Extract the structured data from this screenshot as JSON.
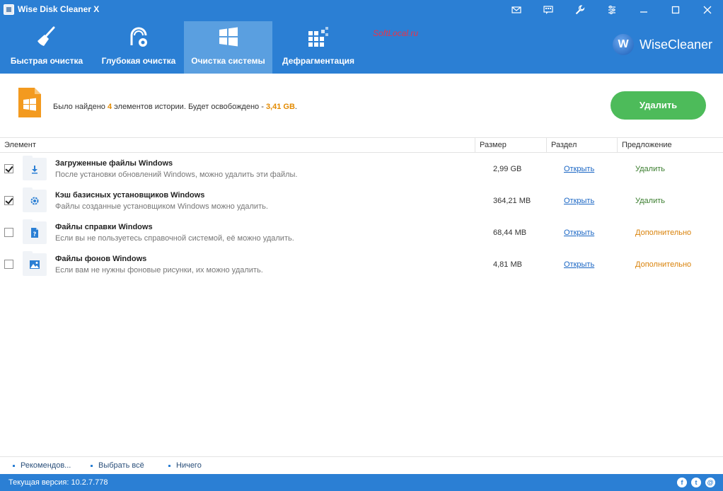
{
  "app": {
    "title": "Wise Disk Cleaner X",
    "watermark": "SoftLocal.ru",
    "brand_initial": "W",
    "brand_name": "WiseCleaner"
  },
  "toolbar": [
    {
      "label": "Быстрая очистка",
      "icon": "broom-icon"
    },
    {
      "label": "Глубокая очистка",
      "icon": "vacuum-icon"
    },
    {
      "label": "Очистка системы",
      "icon": "windows-icon",
      "active": true
    },
    {
      "label": "Дефрагментация",
      "icon": "defrag-icon"
    }
  ],
  "summary": {
    "text_before": "Было найдено ",
    "count": "4",
    "text_mid": " элементов истории. Будет освобождено - ",
    "size": "3,41 GB",
    "text_after": ".",
    "delete_label": "Удалить"
  },
  "table": {
    "headers": {
      "item": "Элемент",
      "size": "Размер",
      "section": "Раздел",
      "suggestion": "Предложение"
    },
    "rows": [
      {
        "checked": true,
        "title": "Загруженные файлы Windows",
        "desc": "После установки обновлений Windows, можно удалить эти файлы.",
        "size": "2,99 GB",
        "link": "Открыть",
        "suggestion": "Удалить",
        "icon": "download-icon"
      },
      {
        "checked": true,
        "title": "Кэш базисных установщиков Windows",
        "desc": "Файлы созданные установщиком Windows можно удалить.",
        "size": "364,21 MB",
        "link": "Открыть",
        "suggestion": "Удалить",
        "icon": "gear-icon"
      },
      {
        "checked": false,
        "title": "Файлы справки Windows",
        "desc": "Если вы не пользуетесь справочной системой, её можно удалить.",
        "size": "68,44 MB",
        "link": "Открыть",
        "suggestion": "Дополнительно",
        "icon": "help-file-icon"
      },
      {
        "checked": false,
        "title": "Файлы фонов Windows",
        "desc": "Если вам не нужны фоновые рисунки, их можно удалить.",
        "size": "4,81 MB",
        "link": "Открыть",
        "suggestion": "Дополнительно",
        "icon": "image-icon"
      }
    ]
  },
  "footer": {
    "recommended": "Рекомендов...",
    "select_all": "Выбрать всё",
    "none": "Ничего",
    "version": "Текущая версия: 10.2.7.778"
  },
  "social": {
    "facebook": "f",
    "twitter": "t",
    "email": "@"
  },
  "colors": {
    "header_blue": "#2b7fd4",
    "active_tab": "#5a9fe0",
    "delete_green": "#4dbb5a",
    "highlight_orange": "#e38a00",
    "suggest_delete": "#3a7d2e",
    "suggest_advanced": "#d9820a"
  }
}
